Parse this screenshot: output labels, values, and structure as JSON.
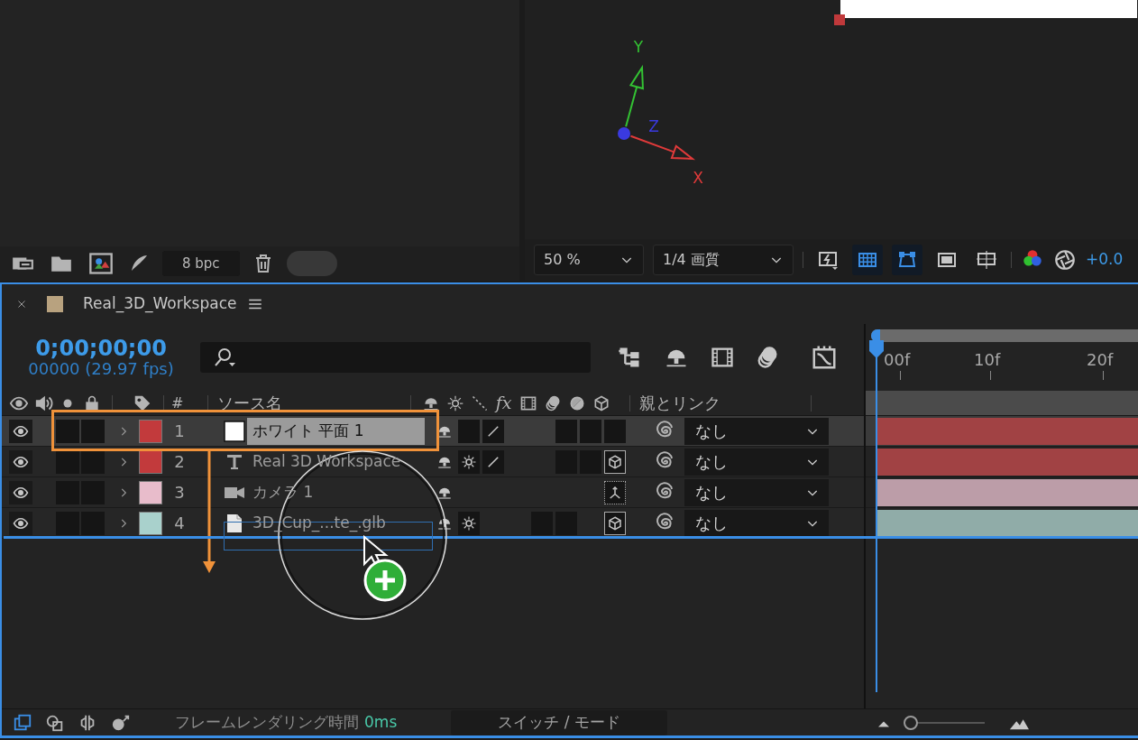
{
  "project": {
    "bit_depth": "8 bpc"
  },
  "viewer": {
    "axes": [
      {
        "label": "Y",
        "color": "#33c233"
      },
      {
        "label": "Z",
        "color": "#3a3ae0"
      },
      {
        "label": "X",
        "color": "#e03a3a"
      }
    ],
    "zoom": "50 %",
    "resolution": "1/4 画質",
    "exposure": "+0.0",
    "toggles": [
      {
        "kind": "fast-preview",
        "on": false
      },
      {
        "kind": "transparency-grid",
        "on": true
      },
      {
        "kind": "mask-path",
        "on": true
      },
      {
        "kind": "region",
        "on": false
      },
      {
        "kind": "guides",
        "on": false
      }
    ]
  },
  "timeline": {
    "title": "Real_3D_Workspace",
    "timecode": "0;00;00;00",
    "frame_info": "00000 (29.97 fps)",
    "ruler": [
      "00f",
      "10f",
      "20f"
    ],
    "columns": {
      "number": "#",
      "source_name": "ソース名",
      "fx": "fx",
      "parent": "親とリンク"
    },
    "layers": [
      {
        "number": "1",
        "name": "ホワイト 平面 1",
        "kind": "solid",
        "color": "#c23a3c",
        "selected": true,
        "visible": true,
        "switches": [
          {
            "kind": "shy"
          },
          {
            "kind": "empty"
          },
          {
            "kind": "line"
          },
          {
            "kind": "none"
          },
          {
            "kind": "none"
          },
          {
            "kind": "empty"
          },
          {
            "kind": "empty"
          },
          {
            "kind": "empty"
          }
        ],
        "parent": "なし"
      },
      {
        "number": "2",
        "name": "Real 3D Workspace",
        "kind": "text",
        "color": "#c23a3c",
        "selected": false,
        "visible": true,
        "switches": [
          {
            "kind": "shy"
          },
          {
            "kind": "sun"
          },
          {
            "kind": "line"
          },
          {
            "kind": "none"
          },
          {
            "kind": "none"
          },
          {
            "kind": "empty"
          },
          {
            "kind": "empty"
          },
          {
            "kind": "cube"
          }
        ],
        "parent": "なし"
      },
      {
        "number": "3",
        "name": "カメラ 1",
        "kind": "camera",
        "color": "#e8bccb",
        "selected": false,
        "visible": true,
        "switches": [
          {
            "kind": "shy"
          },
          {
            "kind": "none"
          },
          {
            "kind": "none"
          },
          {
            "kind": "none"
          },
          {
            "kind": "none"
          },
          {
            "kind": "none"
          },
          {
            "kind": "none"
          },
          {
            "kind": "camera3d"
          }
        ],
        "parent": "なし"
      },
      {
        "number": "4",
        "name": "3D_Cup_...te_.glb",
        "kind": "file",
        "color": "#a9d1cc",
        "selected": false,
        "visible": true,
        "switches": [
          {
            "kind": "shy"
          },
          {
            "kind": "sun"
          },
          {
            "kind": "none"
          },
          {
            "kind": "none"
          },
          {
            "kind": "empty"
          },
          {
            "kind": "empty"
          },
          {
            "kind": "none"
          },
          {
            "kind": "cube"
          }
        ],
        "parent": "なし"
      }
    ],
    "status_bar": {
      "render_label": "フレームレンダリング時間",
      "render_time": "0ms",
      "toggle": "スイッチ / モード",
      "zoom_slider": {
        "level": 0.05
      }
    }
  }
}
